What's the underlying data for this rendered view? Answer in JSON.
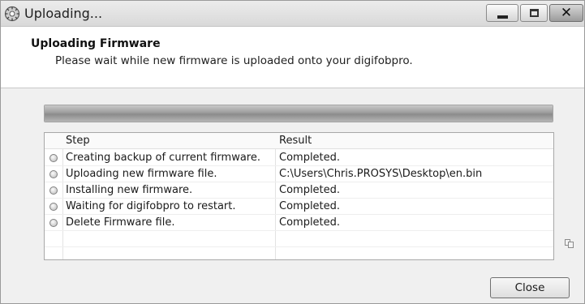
{
  "window": {
    "title": "Uploading..."
  },
  "header": {
    "title": "Uploading Firmware",
    "subtitle": "Please wait while new firmware is uploaded onto your digifobpro."
  },
  "progress": {
    "fraction": 1.0
  },
  "table": {
    "columns": {
      "step": "Step",
      "result": "Result"
    },
    "rows": [
      {
        "step": "Creating backup of current firmware.",
        "result": "Completed."
      },
      {
        "step": "Uploading new firmware file.",
        "result": "C:\\Users\\Chris.PROSYS\\Desktop\\en.bin"
      },
      {
        "step": "Installing new firmware.",
        "result": "Completed."
      },
      {
        "step": "Waiting for digifobpro to restart.",
        "result": "Completed."
      },
      {
        "step": "Delete Firmware file.",
        "result": "Completed."
      }
    ]
  },
  "buttons": {
    "close": "Close"
  },
  "icons": {
    "app": "gear-icon",
    "status": "status-circle-icon",
    "copy": "copy-icon",
    "minimize": "minimize-icon",
    "maximize": "maximize-icon",
    "close": "close-icon"
  }
}
